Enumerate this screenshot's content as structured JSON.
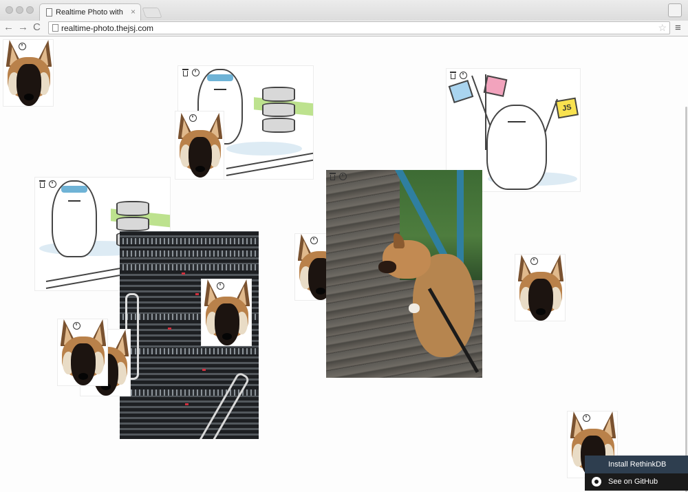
{
  "browser": {
    "tab_title": "Realtime Photo with RethinkDB",
    "tab_close": "×",
    "url": "realtime-photo.thejsj.com",
    "back": "←",
    "forward": "→",
    "reload": "C",
    "bookmark": "☆",
    "menu": "≡"
  },
  "illustration": {
    "js_flag": "JS"
  },
  "widget": {
    "install_label": "Install RethinkDB",
    "github_label": "See on GitHub"
  },
  "icons": {
    "trash": "trash-icon",
    "download": "download-icon",
    "github": "github-icon"
  },
  "colors": {
    "widget_install_bg": "#2e3e4f",
    "widget_github_bg": "#1a1a1a",
    "headband": "#6fb3d6"
  }
}
